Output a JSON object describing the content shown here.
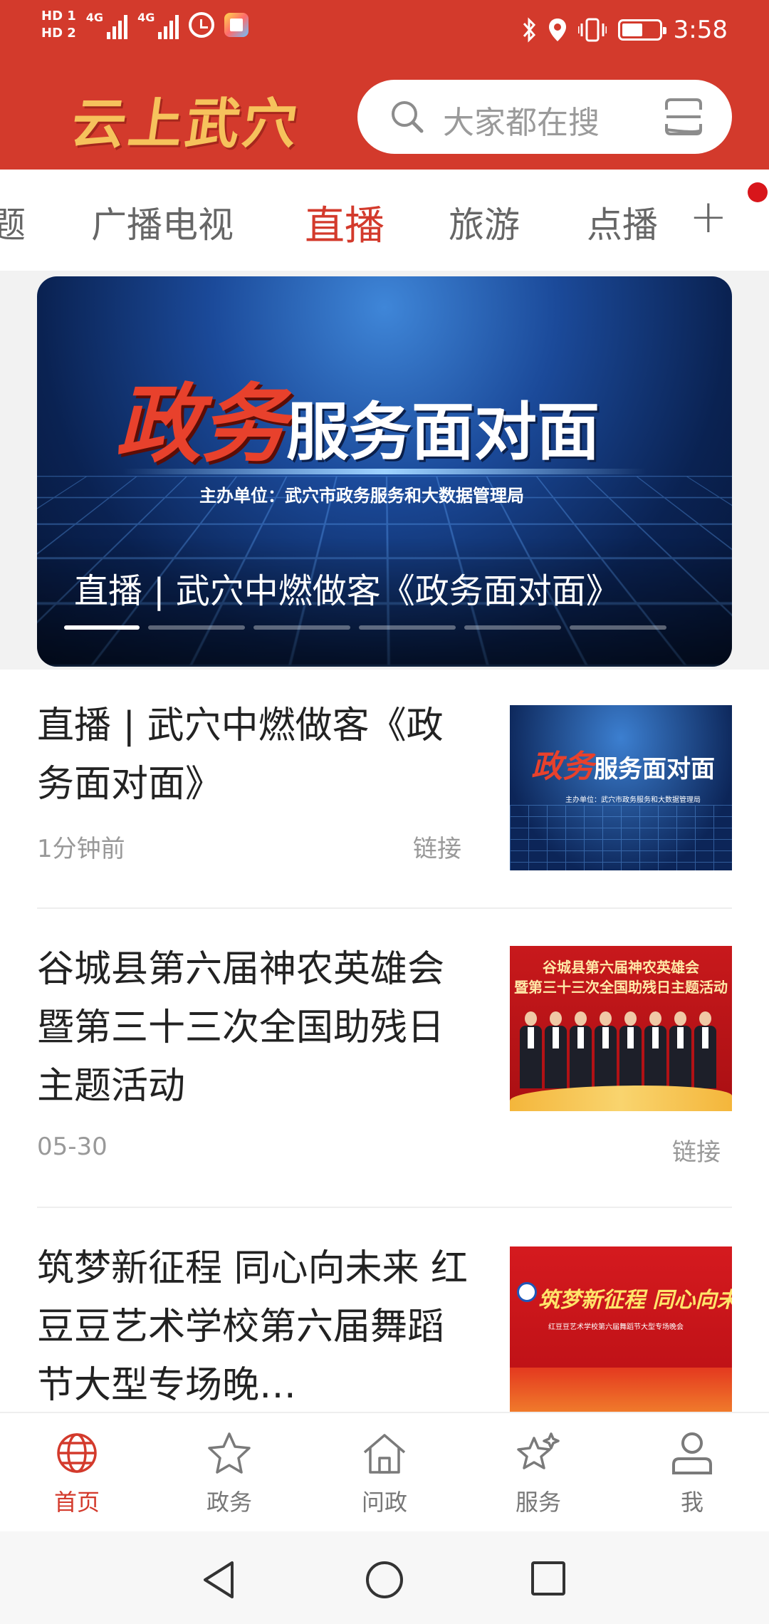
{
  "status_bar": {
    "hd1": "HD 1",
    "hd2": "HD 2",
    "net1": "4G",
    "net2": "4G",
    "time": "3:58",
    "battery_level": 0.55,
    "icons": [
      "hd-icon",
      "signal-icon",
      "signal-icon",
      "alarm-icon",
      "app-notification-icon",
      "bluetooth-icon",
      "location-icon",
      "vibrate-icon",
      "battery-icon"
    ]
  },
  "header": {
    "logo_text": "云上武穴",
    "search_placeholder": "大家都在搜",
    "accent": "#d33a2c"
  },
  "channels": {
    "items": [
      "题",
      "广播电视",
      "直播",
      "旅游",
      "点播"
    ],
    "active_index": 2,
    "add_label": "+"
  },
  "banner": {
    "title_red": "政务",
    "title_white": "服务面对面",
    "host": "主办单位：武穴市政务服务和大数据管理局",
    "caption": "直播 | 武穴中燃做客《政务面对面》",
    "slide_count": 6,
    "current_slide": 1
  },
  "news": [
    {
      "title": "直播 | 武穴中燃做客《政务面对面》",
      "time": "1分钟前",
      "tag": "链接",
      "thumb_title_red": "政务",
      "thumb_title_white": "服务面对面",
      "thumb_sub": "主办单位：武穴市政务服务和大数据管理局"
    },
    {
      "title": "谷城县第六届神农英雄会暨第三十三次全国助残日主题活动",
      "time": "05-30",
      "tag": "链接",
      "thumb_line1": "谷城县第六届神农英雄会",
      "thumb_line2": "暨第三十三次全国助残日主题活动"
    },
    {
      "title": "筑梦新征程 同心向未来 红豆豆艺术学校第六届舞蹈节大型专场晚…",
      "thumb_title": "筑梦新征程  同心向未来",
      "thumb_sub": "红豆豆艺术学校第六届舞蹈节大型专场晚会"
    }
  ],
  "bottom_nav": [
    {
      "label": "首页",
      "icon": "globe-icon",
      "active": true
    },
    {
      "label": "政务",
      "icon": "star-icon",
      "active": false
    },
    {
      "label": "问政",
      "icon": "home-icon",
      "active": false
    },
    {
      "label": "服务",
      "icon": "sparkle-star-icon",
      "active": false
    },
    {
      "label": "我",
      "icon": "person-icon",
      "active": false
    }
  ],
  "system_nav": [
    "back-icon",
    "home-circle-icon",
    "recents-icon"
  ]
}
